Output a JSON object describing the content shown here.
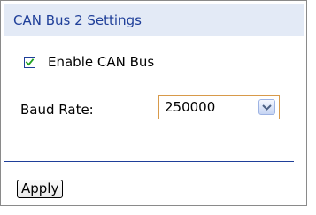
{
  "panel": {
    "title": "CAN Bus 2 Settings"
  },
  "enable_can_bus": {
    "label": "Enable CAN Bus",
    "checked": true,
    "icon": "checkmark-icon"
  },
  "baud_rate": {
    "label": "Baud Rate:",
    "selected_value": "250000",
    "icon": "chevron-down-icon"
  },
  "apply_button": {
    "label": "Apply"
  },
  "colors": {
    "header_background": "#e3eaf6",
    "title_text": "#1f3f99",
    "divider": "#1f3f99",
    "select_border": "#d89a4a",
    "checkmark": "#21a121"
  }
}
